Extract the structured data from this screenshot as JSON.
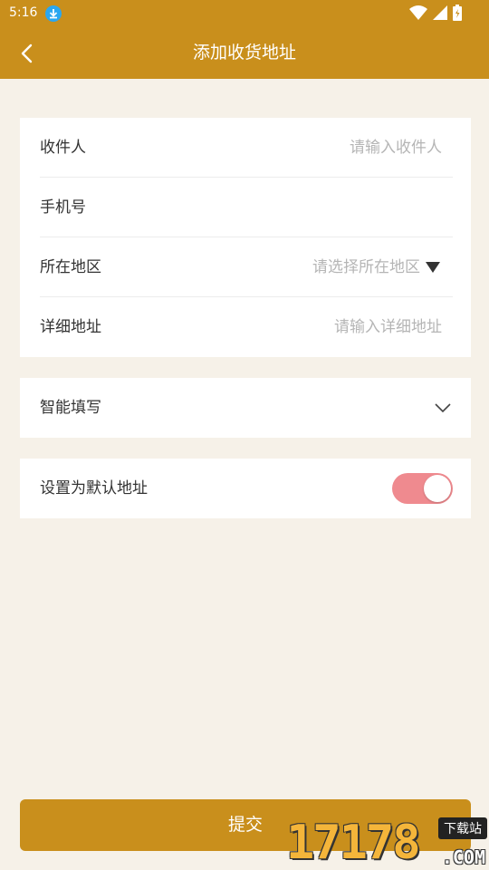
{
  "status_bar": {
    "time": "5:16",
    "icons": [
      "download-icon",
      "wifi-icon",
      "cell-signal-icon",
      "battery-icon"
    ]
  },
  "header": {
    "title": "添加收货地址",
    "back_icon": "chevron-left-icon"
  },
  "address_form": {
    "recipient": {
      "label": "收件人",
      "placeholder": "请输入收件人"
    },
    "phone": {
      "label": "手机号",
      "placeholder": ""
    },
    "region": {
      "label": "所在地区",
      "placeholder": "请选择所在地区",
      "icon": "caret-down-icon"
    },
    "detail": {
      "label": "详细地址",
      "placeholder": "请输入详细地址"
    }
  },
  "smart_fill": {
    "label": "智能填写",
    "icon": "chevron-down-icon"
  },
  "default_address": {
    "label": "设置为默认地址",
    "enabled": true
  },
  "submit": {
    "label": "提交"
  },
  "watermark": {
    "number": "17178",
    "tag": "下载站",
    "domain": ".COM"
  },
  "colors": {
    "accent": "#c98f1c",
    "background": "#f6f1e8",
    "toggle_on": "#ef8a8f",
    "placeholder": "#b5b5b5"
  }
}
